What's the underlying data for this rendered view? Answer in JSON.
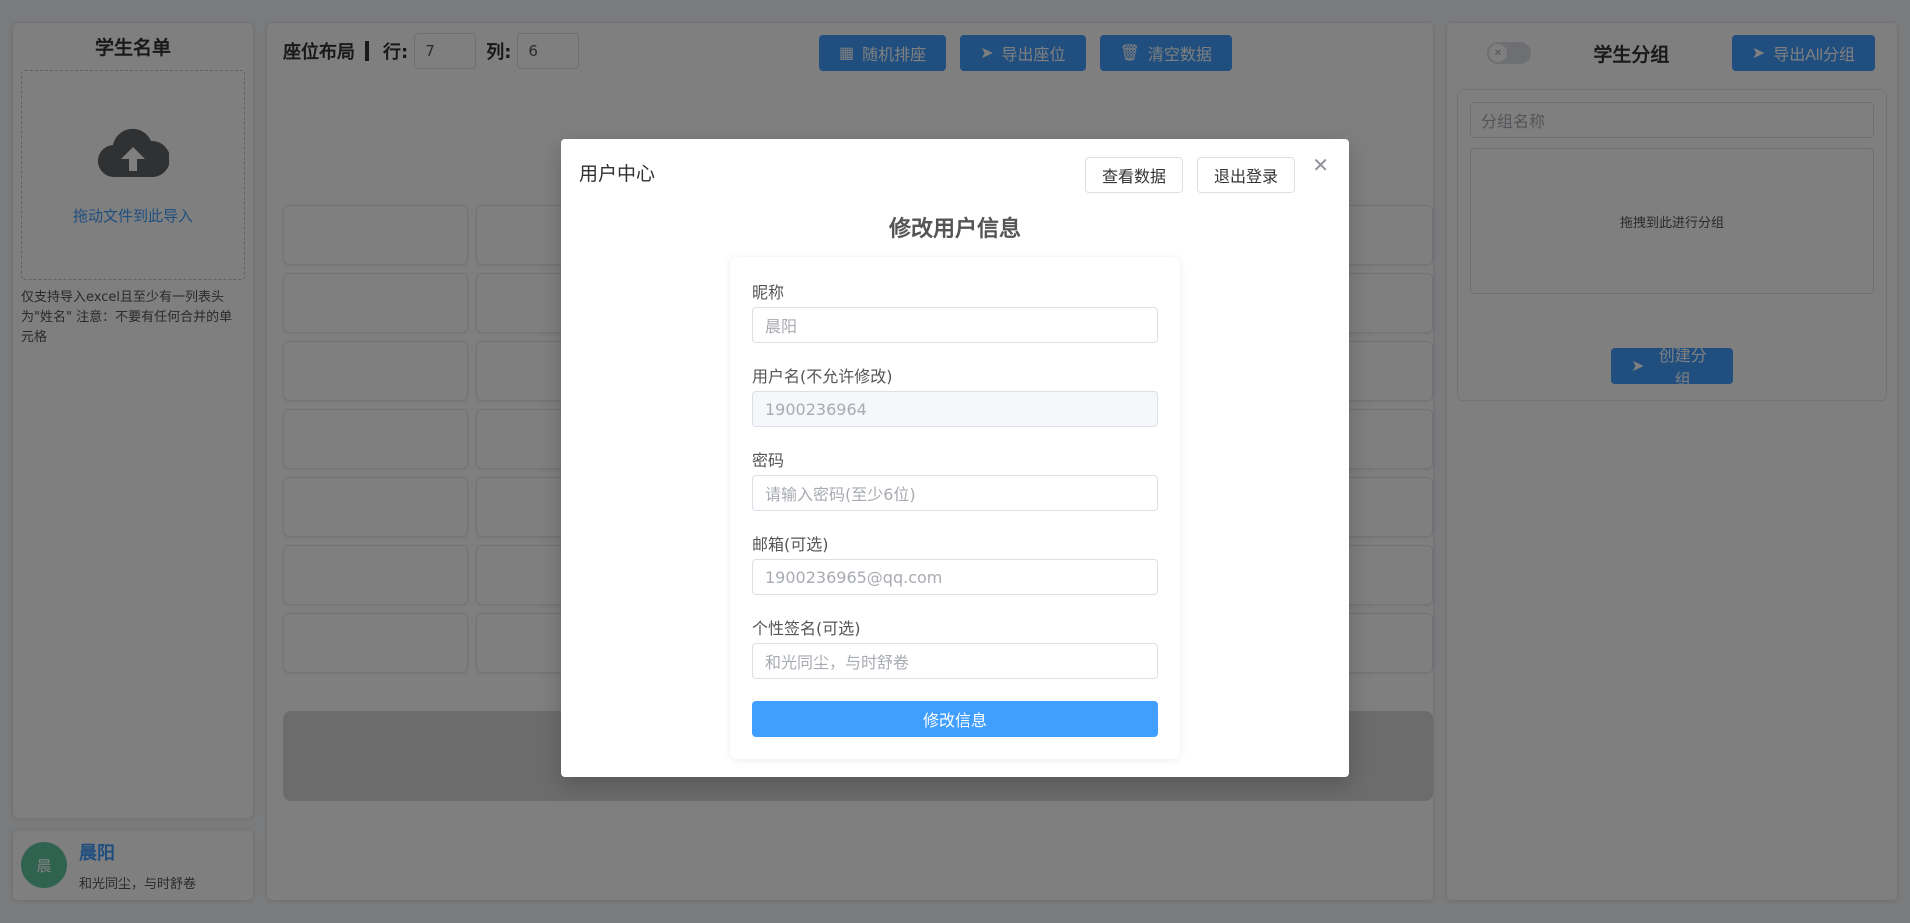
{
  "left": {
    "title": "学生名单",
    "upload_text": "拖动文件到此导入",
    "tip": "仅支持导入excel且至少有一列表头为\"姓名\" 注意：不要有任何合并的单元格",
    "user": {
      "avatar": "晨",
      "name": "晨阳",
      "sign": "和光同尘，与时舒卷"
    }
  },
  "toolbar": {
    "layout_label": "座位布局",
    "rows_label": "行:",
    "rows_value": "7",
    "cols_label": "列:",
    "cols_value": "6",
    "buttons": [
      "随机排座",
      "导出座位",
      "清空数据"
    ]
  },
  "right": {
    "title": "学生分组",
    "export_label": "导出All分组",
    "group_name_placeholder": "分组名称",
    "drop_text": "拖拽到此进行分组",
    "create_label": "创建分组"
  },
  "modal": {
    "title": "用户中心",
    "view_data": "查看数据",
    "logout": "退出登录",
    "form_title": "修改用户信息",
    "fields": [
      {
        "label": "昵称",
        "value": "晨阳"
      },
      {
        "label": "用户名(不允许修改)",
        "value": "1900236964"
      },
      {
        "label": "密码",
        "value": "请输入密码(至少6位)"
      },
      {
        "label": "邮箱(可选)",
        "value": "1900236965@qq.com"
      },
      {
        "label": "个性签名(可选)",
        "value": "和光同尘，与时舒卷"
      }
    ],
    "submit": "修改信息"
  },
  "colors": {
    "primary": "#409eff",
    "avatar": "#5ec7a0"
  }
}
